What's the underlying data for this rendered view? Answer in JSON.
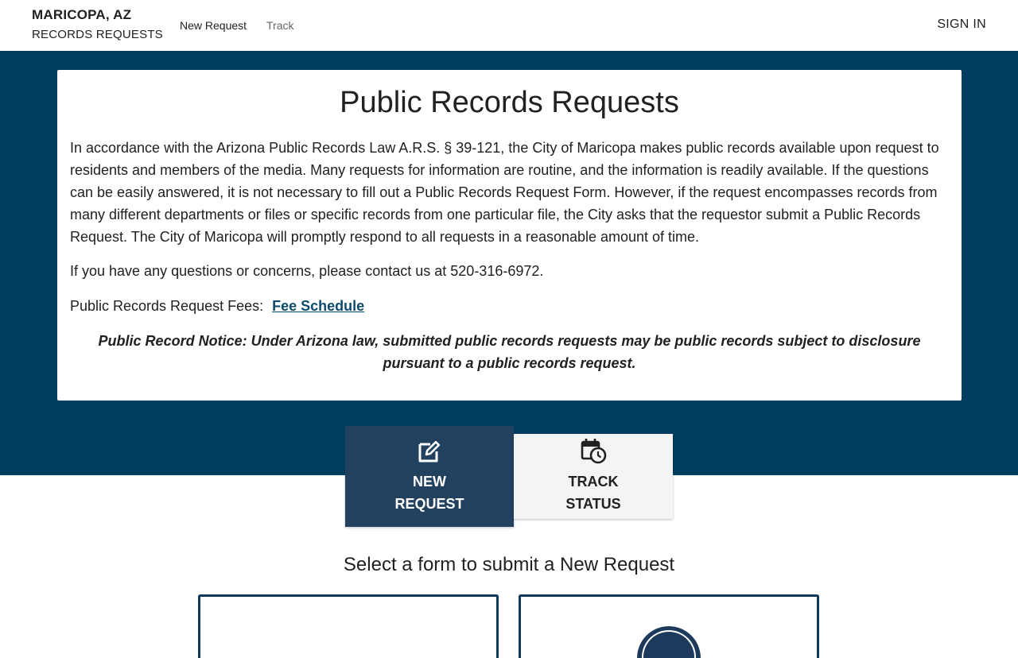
{
  "header": {
    "city": "MARICOPA, AZ",
    "subtitle": "RECORDS REQUESTS",
    "nav": {
      "new_request": "New Request",
      "track": "Track"
    },
    "sign_in": "SIGN IN"
  },
  "intro": {
    "title": "Public Records Requests",
    "paragraph1": "In accordance with the Arizona Public Records Law A.R.S. § 39-121, the City of Maricopa makes public records available upon request to residents and members of the media. Many requests for information are routine, and the information is readily available. If the questions can be easily answered, it is not necessary to fill out a Public Records Request Form. However, if the request encompasses records from many different departments or files or specific records from one particular file, the City asks that the requestor submit a Public Records Request. The City of Maricopa will promptly respond to all requests in a reasonable amount of time.",
    "paragraph2": "If you have any questions or concerns, please contact us at 520-316-6972.",
    "fees_label": "Public Records Request Fees:",
    "fee_link": "Fee Schedule",
    "notice": "Public Record Notice: Under Arizona law,  submitted public records requests may be public records subject to disclosure pursuant to a public records request."
  },
  "tabs": {
    "new_request": {
      "line1": "NEW",
      "line2": "REQUEST",
      "icon": "edit-icon"
    },
    "track_status": {
      "line1": "TRACK",
      "line2": "STATUS",
      "icon": "calendar-clock-icon"
    }
  },
  "forms_section": {
    "title": "Select a form to submit a New Request"
  },
  "colors": {
    "banner": "#003e61",
    "active_tab": "#22415f",
    "inactive_tab": "#f4f4f4",
    "link": "#0b4b6e",
    "form_card_border": "#0d3b5c"
  }
}
